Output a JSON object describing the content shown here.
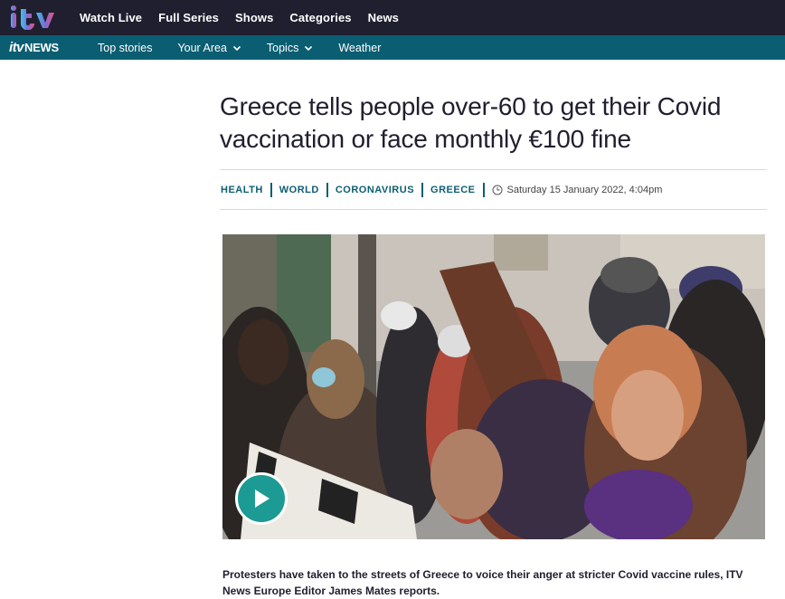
{
  "brand": {
    "logo_text": "itv",
    "news_logo_itv": "itv",
    "news_logo_news": "NEWS"
  },
  "top_nav": [
    "Watch Live",
    "Full Series",
    "Shows",
    "Categories",
    "News"
  ],
  "news_nav": [
    {
      "label": "Top stories",
      "has_dropdown": false
    },
    {
      "label": "Your Area",
      "has_dropdown": true
    },
    {
      "label": "Topics",
      "has_dropdown": true
    },
    {
      "label": "Weather",
      "has_dropdown": false
    }
  ],
  "article": {
    "headline": "Greece tells people over-60 to get their Covid vaccination or face monthly €100 fine",
    "tags": [
      "HEALTH",
      "WORLD",
      "CORONAVIRUS",
      "GREECE"
    ],
    "date": "Saturday 15 January 2022, 4:04pm",
    "caption": "Protesters have taken to the streets of Greece to voice their anger at stricter Covid vaccine rules, ITV News Europe Editor James Mates reports."
  },
  "colors": {
    "top_bar": "#1f1f2f",
    "news_bar": "#0b5e72",
    "accent": "#0b5e72",
    "play_button": "#1c9a94"
  },
  "icons": {
    "clock": "clock-icon",
    "play": "play-icon",
    "chevron": "chevron-down-icon"
  }
}
